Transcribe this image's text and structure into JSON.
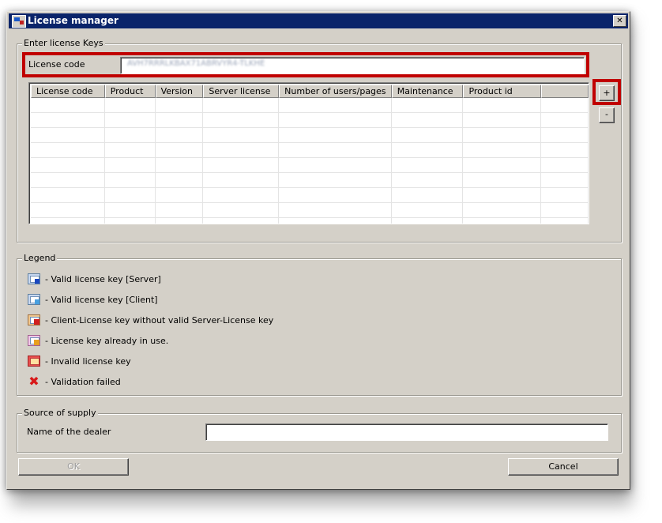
{
  "window": {
    "title": "License manager",
    "close_glyph": "✕"
  },
  "keys_group": {
    "label": "Enter license Keys",
    "license_code_label": "License code",
    "license_code_value": "AVH7RRRLKBAX71ABRVYR4-TLKHE",
    "table": {
      "columns": [
        "License code",
        "Product",
        "Version",
        "Server license",
        "Number of users/pages",
        "Maintenance",
        "Product id",
        ""
      ],
      "row_count": 9
    },
    "add_label": "+",
    "remove_label": "-"
  },
  "legend_group": {
    "label": "Legend",
    "items": [
      {
        "icon": "valid-server-license-icon",
        "text": "- Valid license key [Server]"
      },
      {
        "icon": "valid-client-license-icon",
        "text": "- Valid license key [Client]"
      },
      {
        "icon": "client-without-server-icon",
        "text": "- Client-License key without valid Server-License key"
      },
      {
        "icon": "license-in-use-icon",
        "text": "- License key already in use."
      },
      {
        "icon": "invalid-license-icon",
        "text": "- Invalid license key"
      },
      {
        "icon": "validation-failed-icon",
        "text": "- Validation failed"
      }
    ]
  },
  "supply_group": {
    "label": "Source of supply",
    "dealer_label": "Name of the dealer",
    "dealer_value": ""
  },
  "buttons": {
    "ok": "OK",
    "cancel": "Cancel"
  },
  "colors": {
    "title_bar": "#0a246a",
    "highlight": "#c00000",
    "dialog_face": "#d4d0c8"
  }
}
